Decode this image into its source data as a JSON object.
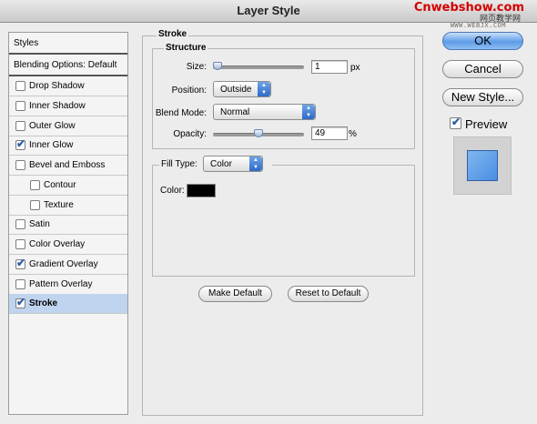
{
  "window": {
    "title": "Layer Style"
  },
  "watermark": {
    "line1": "Cnwebshow.com",
    "line2": "网页教学网",
    "line3": "WWW.WEBJX.COM"
  },
  "styles_panel": {
    "header": "Styles",
    "blending": "Blending Options: Default",
    "items": [
      {
        "label": "Drop Shadow",
        "checked": false,
        "indent": false,
        "selected": false
      },
      {
        "label": "Inner Shadow",
        "checked": false,
        "indent": false,
        "selected": false
      },
      {
        "label": "Outer Glow",
        "checked": false,
        "indent": false,
        "selected": false
      },
      {
        "label": "Inner Glow",
        "checked": true,
        "indent": false,
        "selected": false
      },
      {
        "label": "Bevel and Emboss",
        "checked": false,
        "indent": false,
        "selected": false
      },
      {
        "label": "Contour",
        "checked": false,
        "indent": true,
        "selected": false
      },
      {
        "label": "Texture",
        "checked": false,
        "indent": true,
        "selected": false
      },
      {
        "label": "Satin",
        "checked": false,
        "indent": false,
        "selected": false
      },
      {
        "label": "Color Overlay",
        "checked": false,
        "indent": false,
        "selected": false
      },
      {
        "label": "Gradient Overlay",
        "checked": true,
        "indent": false,
        "selected": false
      },
      {
        "label": "Pattern Overlay",
        "checked": false,
        "indent": false,
        "selected": false
      },
      {
        "label": "Stroke",
        "checked": true,
        "indent": false,
        "selected": true
      }
    ]
  },
  "stroke": {
    "title": "Stroke",
    "structure": {
      "title": "Structure",
      "size_label": "Size:",
      "size_value": "1",
      "size_unit": "px",
      "size_slider": 0.0,
      "position_label": "Position:",
      "position_value": "Outside",
      "blend_label": "Blend Mode:",
      "blend_value": "Normal",
      "opacity_label": "Opacity:",
      "opacity_value": "49",
      "opacity_unit": "%",
      "opacity_slider": 0.49
    },
    "fill": {
      "type_label": "Fill Type:",
      "type_value": "Color",
      "color_label": "Color:",
      "color_value": "#000000"
    },
    "make_default": "Make Default",
    "reset_default": "Reset to Default"
  },
  "buttons": {
    "ok": "OK",
    "cancel": "Cancel",
    "new_style": "New Style...",
    "preview": "Preview",
    "preview_checked": true
  },
  "colors": {
    "accent": "#5f9ce8",
    "selection": "#bfd4ee",
    "preview_swatch": "#4a8ee3"
  }
}
